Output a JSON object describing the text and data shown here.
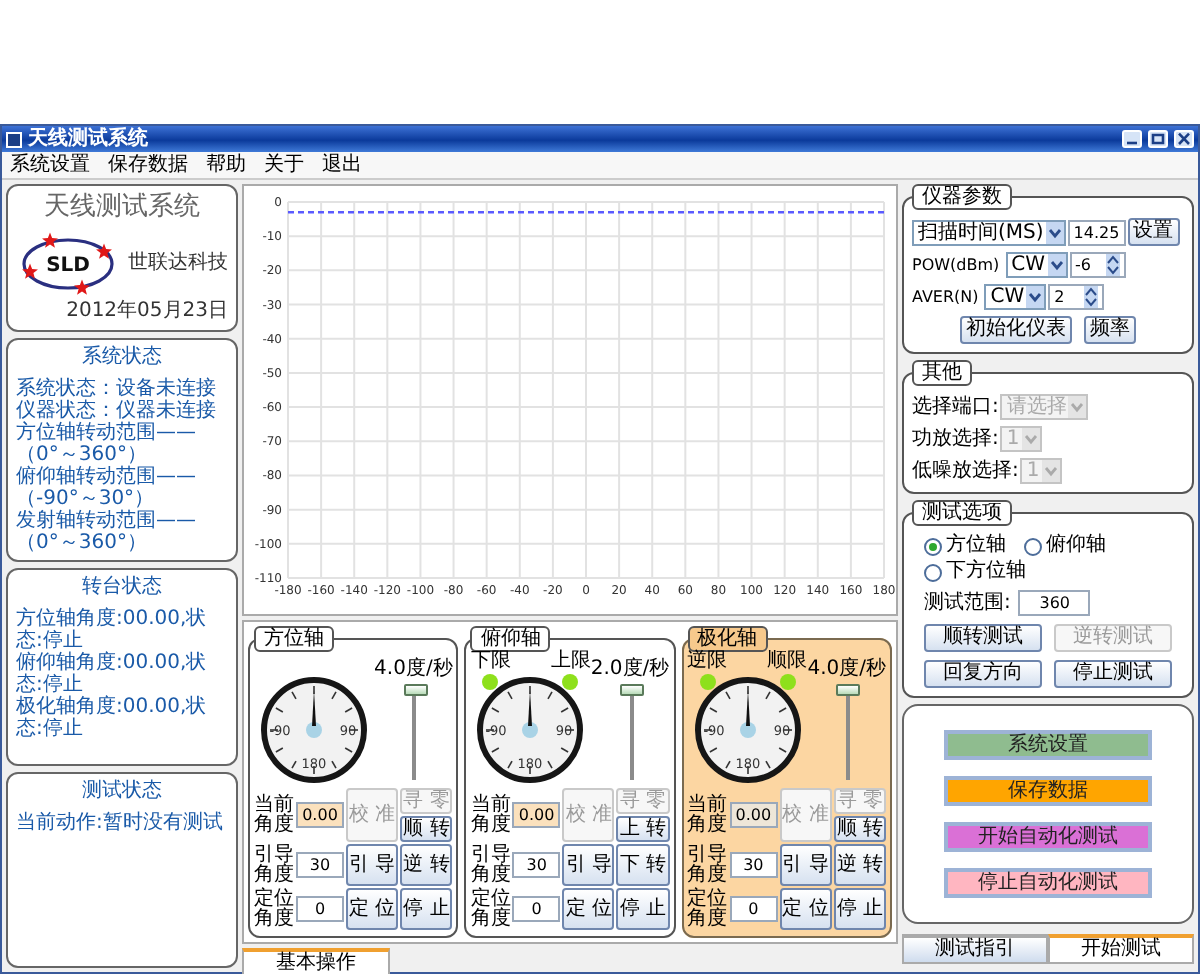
{
  "window": {
    "title": "天线测试系统"
  },
  "menu": [
    "系统设置",
    "保存数据",
    "帮助",
    "关于",
    "退出"
  ],
  "logo_card": {
    "title": "天线测试系统",
    "logo_text": "SLD",
    "company": "世联达科技",
    "date": "2012年05月23日"
  },
  "system_status": {
    "title": "系统状态",
    "lines": [
      "系统状态：设备未连接",
      "仪器状态：仪器未连接",
      "方位轴转动范围——（0°～360°）",
      "俯仰轴转动范围——（-90°～30°）",
      "发射轴转动范围——（0°～360°）"
    ]
  },
  "turntable_status": {
    "title": "转台状态",
    "lines": [
      "方位轴角度:00.00,状态:停止",
      "俯仰轴角度:00.00,状态:停止",
      "极化轴角度:00.00,状态:停止"
    ]
  },
  "test_status": {
    "title": "测试状态",
    "lines": [
      "当前动作:暂时没有测试"
    ]
  },
  "chart": {
    "chart_data": {
      "type": "line",
      "grid": true,
      "categories": [
        "-180",
        "-160",
        "-140",
        "-120",
        "-100",
        "-80",
        "-60",
        "-40",
        "-20",
        "0",
        "20",
        "40",
        "60",
        "80",
        "100",
        "120",
        "140",
        "160",
        "180"
      ],
      "series": [
        {
          "color": "#5a5aff",
          "line_style": "dashed",
          "values": [
            -3,
            -3,
            -3,
            -3,
            -3,
            -3,
            -3,
            -3,
            -3,
            -3,
            -3,
            -3,
            -3,
            -3,
            -3,
            -3,
            -3,
            -3,
            -3
          ]
        }
      ],
      "ylim": [
        -110,
        0
      ],
      "yticks": [
        0,
        -10,
        -20,
        -30,
        -40,
        -50,
        -60,
        -70,
        -80,
        -90,
        -100,
        -110
      ]
    }
  },
  "axes": [
    {
      "title": "方位轴",
      "selected": false,
      "speed": "4.0度/秒",
      "level": 1,
      "dial_labels": [
        "-90",
        "90",
        "180"
      ],
      "fields": [
        {
          "label": "当前角度",
          "value": "0.00",
          "kind": "readout"
        },
        {
          "label": "引导角度",
          "value": "30",
          "kind": "input"
        },
        {
          "label": "定位角度",
          "value": "0",
          "kind": "input"
        }
      ],
      "buttons": [
        {
          "label": "校 准",
          "disabled": true
        },
        {
          "label": "引 导",
          "disabled": false
        },
        {
          "label": "定 位",
          "disabled": false
        },
        {
          "label": "寻 零",
          "disabled": true
        },
        {
          "label": "顺 转",
          "disabled": false
        },
        {
          "label": "逆 转",
          "disabled": false
        },
        {
          "label": "停 止",
          "disabled": false
        }
      ]
    },
    {
      "title": "俯仰轴",
      "selected": false,
      "limits": [
        {
          "label": "下限",
          "on": true
        },
        {
          "label": "上限",
          "on": true
        }
      ],
      "speed": "2.0度/秒",
      "level": 1,
      "dial_labels": [
        "-90",
        "90",
        "180"
      ],
      "fields": [
        {
          "label": "当前角度",
          "value": "0.00",
          "kind": "readout"
        },
        {
          "label": "引导角度",
          "value": "30",
          "kind": "input"
        },
        {
          "label": "定位角度",
          "value": "0",
          "kind": "input"
        }
      ],
      "buttons": [
        {
          "label": "校 准",
          "disabled": true
        },
        {
          "label": "引 导",
          "disabled": false
        },
        {
          "label": "定 位",
          "disabled": false
        },
        {
          "label": "寻 零",
          "disabled": true
        },
        {
          "label": "上 转",
          "disabled": false
        },
        {
          "label": "下 转",
          "disabled": false
        },
        {
          "label": "停 止",
          "disabled": false
        }
      ]
    },
    {
      "title": "极化轴",
      "selected": true,
      "limits": [
        {
          "label": "逆限",
          "on": true
        },
        {
          "label": "顺限",
          "on": true
        }
      ],
      "speed": "4.0度/秒",
      "level": 1,
      "dial_labels": [
        "-90",
        "90",
        "180"
      ],
      "fields": [
        {
          "label": "当前角度",
          "value": "0.00",
          "kind": "readout"
        },
        {
          "label": "引导角度",
          "value": "30",
          "kind": "input"
        },
        {
          "label": "定位角度",
          "value": "0",
          "kind": "input"
        }
      ],
      "buttons": [
        {
          "label": "校 准",
          "disabled": true
        },
        {
          "label": "引 导",
          "disabled": false
        },
        {
          "label": "定 位",
          "disabled": false
        },
        {
          "label": "寻 零",
          "disabled": true
        },
        {
          "label": "顺 转",
          "disabled": false
        },
        {
          "label": "逆 转",
          "disabled": false
        },
        {
          "label": "停 止",
          "disabled": false
        }
      ]
    }
  ],
  "bottom_tabs": [
    {
      "label": "基本操作",
      "selected": true
    }
  ],
  "instrument": {
    "title": "仪器参数",
    "sweep": {
      "select": "扫描时间(MS)",
      "value": "14.25"
    },
    "set_button": "设置",
    "pow": {
      "label": "POW(dBm)",
      "select": "CW",
      "value": "-6"
    },
    "aver": {
      "label": "AVER(N)",
      "select": "CW",
      "value": "2"
    },
    "buttons": [
      "初始化仪表",
      "频率"
    ]
  },
  "other": {
    "title": "其他",
    "rows": [
      {
        "label": "选择端口:",
        "value": "请选择",
        "disabled": true
      },
      {
        "label": "功放选择:",
        "value": "1",
        "disabled": true
      },
      {
        "label": "低噪放选择:",
        "value": "1",
        "disabled": true
      }
    ]
  },
  "test_options": {
    "title": "测试选项",
    "radios": [
      {
        "label": "方位轴",
        "selected": true
      },
      {
        "label": "俯仰轴",
        "selected": false
      },
      {
        "label": "下方位轴",
        "selected": false
      }
    ],
    "range_label": "测试范围:",
    "range": "360",
    "buttons": [
      {
        "label": "顺转测试",
        "disabled": false
      },
      {
        "label": "逆转测试",
        "disabled": true
      },
      {
        "label": "回复方向",
        "disabled": false
      },
      {
        "label": "停止测试",
        "disabled": false
      }
    ]
  },
  "actions": [
    {
      "label": "系统设置",
      "color": "#8fbc8f"
    },
    {
      "label": "保存数据",
      "color": "#ffa500"
    },
    {
      "label": "开始自动化测试",
      "color": "#da70d6"
    },
    {
      "label": "停止自动化测试",
      "color": "#ffb6c1"
    }
  ],
  "right_tabs": [
    {
      "label": "测试指引",
      "selected": false
    },
    {
      "label": "开始测试",
      "selected": true
    }
  ]
}
